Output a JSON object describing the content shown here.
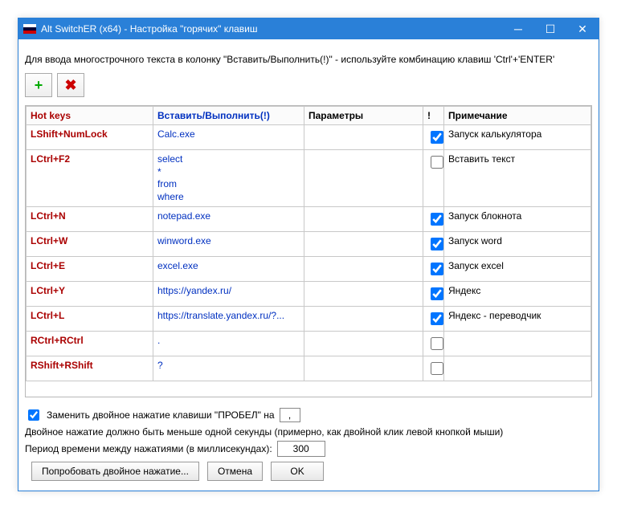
{
  "window": {
    "title": "Alt SwitchER (x64) - Настройка \"горячих\" клавиш"
  },
  "hint": "Для ввода многострочного текста в колонку \"Вставить/Выполнить(!)\" - используйте комбинацию клавиш 'Ctrl'+'ENTER'",
  "columns": {
    "hotkeys": "Hot keys",
    "insert": "Вставить/Выполнить(!)",
    "params": "Параметры",
    "flag": "!",
    "note": "Примечание"
  },
  "rows": [
    {
      "hotkey": "LShift+NumLock",
      "insert": "Calc.exe",
      "params": "",
      "checked": true,
      "note": "Запуск калькулятора"
    },
    {
      "hotkey": "LCtrl+F2",
      "insert": "select\n*\nfrom\nwhere",
      "params": "",
      "checked": false,
      "note": "Вставить текст"
    },
    {
      "hotkey": "LCtrl+N",
      "insert": "notepad.exe",
      "params": "",
      "checked": true,
      "note": "Запуск блокнота"
    },
    {
      "hotkey": "LCtrl+W",
      "insert": "winword.exe",
      "params": "",
      "checked": true,
      "note": "Запуск word"
    },
    {
      "hotkey": "LCtrl+E",
      "insert": "excel.exe",
      "params": "",
      "checked": true,
      "note": "Запуск excel"
    },
    {
      "hotkey": "LCtrl+Y",
      "insert": "https://yandex.ru/",
      "params": "",
      "checked": true,
      "note": "Яндекс"
    },
    {
      "hotkey": "LCtrl+L",
      "insert": "https://translate.yandex.ru/?...",
      "params": "",
      "checked": true,
      "note": "Яндекс - переводчик"
    },
    {
      "hotkey": "RCtrl+RCtrl",
      "insert": ".",
      "params": "",
      "checked": false,
      "note": ""
    },
    {
      "hotkey": "RShift+RShift",
      "insert": "?",
      "params": "",
      "checked": false,
      "note": ""
    }
  ],
  "bottom": {
    "replace_label": "Заменить двойное нажатие клавиши \"ПРОБЕЛ\" на",
    "replace_checked": true,
    "replace_char": ",",
    "hint2": "Двойное нажатие должно быть меньше одной секунды (примерно, как двойной клик левой кнопкой мыши)",
    "period_label": "Период времени между нажатиями (в миллисекундах):",
    "period_value": "300",
    "try_label": "Попробовать двойное нажатие...",
    "cancel": "Отмена",
    "ok": "OK"
  }
}
